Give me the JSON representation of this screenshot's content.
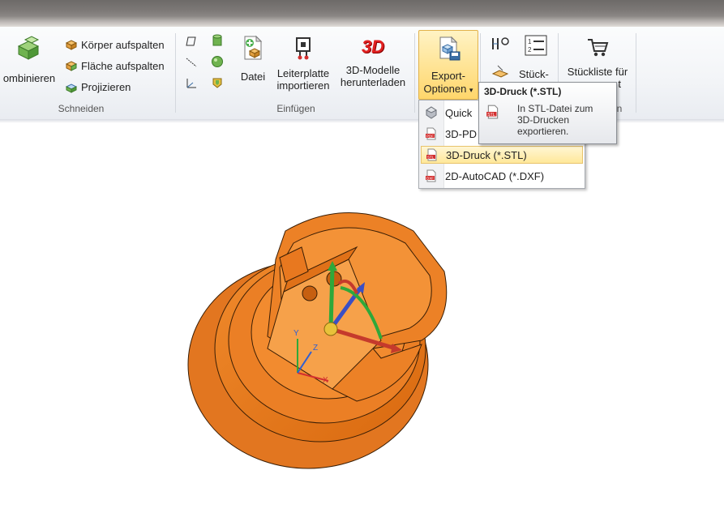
{
  "ribbon": {
    "schneiden": {
      "label": "Schneiden",
      "kombinieren": "ombinieren",
      "koerper_aufspalten": "Körper aufspalten",
      "flaeche_aufspalten": "Fläche aufspalten",
      "projizieren": "Projizieren"
    },
    "einfuegen": {
      "label": "Einfügen",
      "datei": "Datei",
      "leiterplatte_1": "Leiterplatte",
      "leiterplatte_2": "importieren",
      "modelle_1": "3D-Modelle",
      "modelle_2": "herunterladen",
      "modelle_icon_text": "3D"
    },
    "export": {
      "line1": "Export-",
      "line2": "Optionen",
      "arrow": "▾"
    },
    "stueck": {
      "line1": "Stück-"
    },
    "stueckliste": {
      "line1": "Stückliste für",
      "line2_visible": "t"
    },
    "group_label_partial": "n"
  },
  "export_menu": {
    "items": [
      {
        "label": "Quick",
        "icon": "quick-icon"
      },
      {
        "label": "3D-PD",
        "icon": "pdf-icon"
      },
      {
        "label": "3D-Druck (*.STL)",
        "icon": "stl-icon"
      },
      {
        "label": "2D-AutoCAD (*.DXF)",
        "icon": "dxf-icon"
      }
    ],
    "highlighted_index": 2
  },
  "tooltip": {
    "title": "3D-Druck (*.STL)",
    "line1": "In STL-Datei zum",
    "line2": "3D-Drucken",
    "line3": "exportieren."
  },
  "viewport": {
    "axis_x": "X",
    "axis_y": "Y",
    "axis_z": "Z",
    "model_color": "#e8791f"
  }
}
